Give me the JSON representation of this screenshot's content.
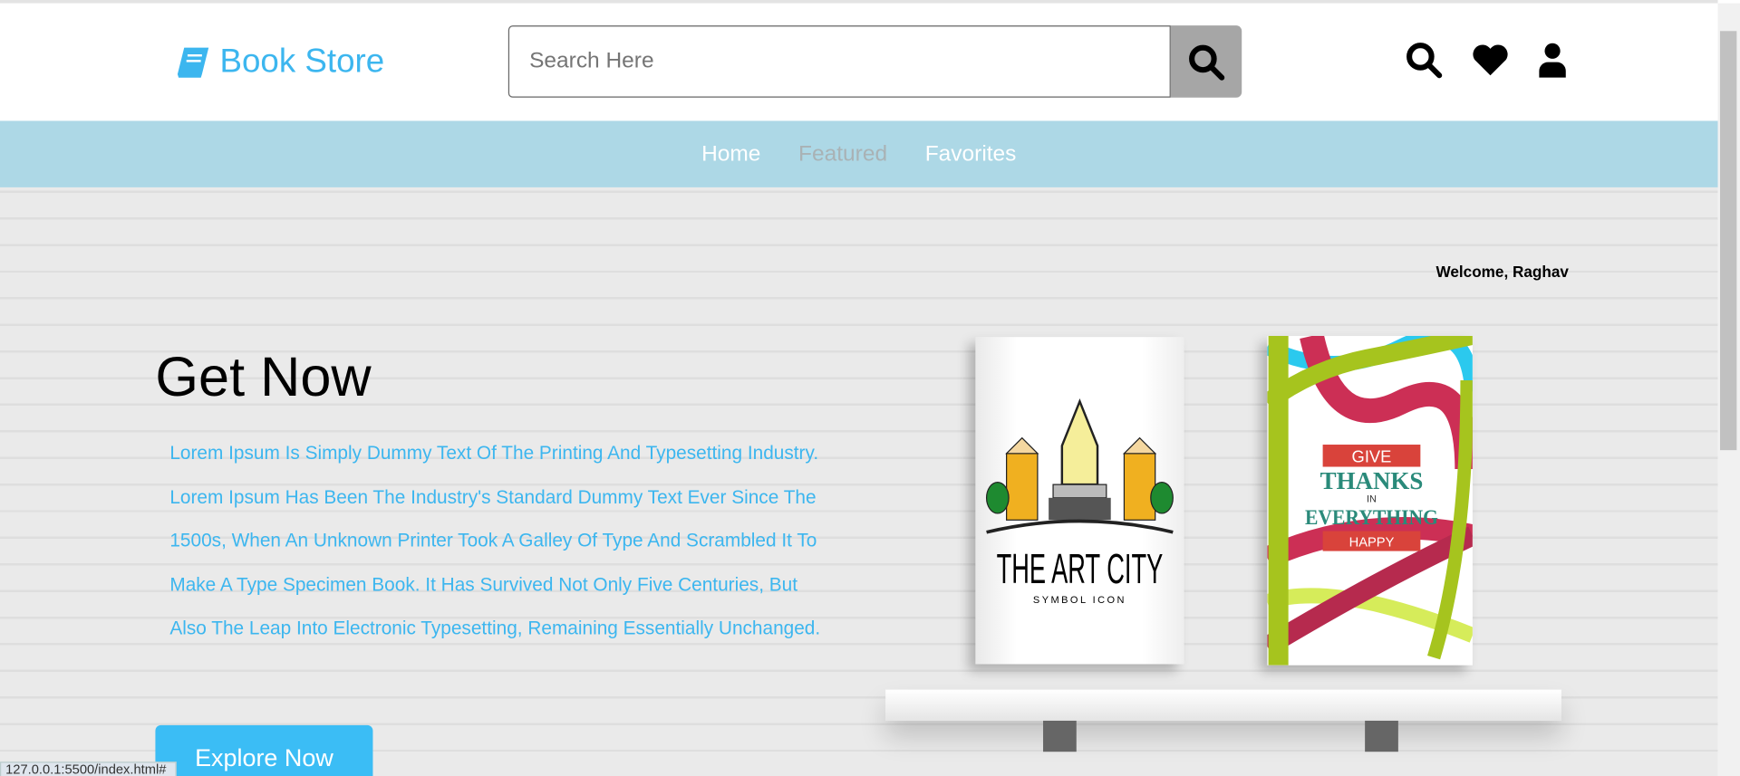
{
  "header": {
    "logo_text": "Book Store",
    "logo_icon": "book-icon",
    "search_placeholder": "Search Here",
    "icons": [
      "search-icon",
      "heart-icon",
      "user-icon"
    ]
  },
  "nav": {
    "items": [
      {
        "label": "Home"
      },
      {
        "label": "Featured",
        "active": true
      },
      {
        "label": "Favorites"
      }
    ]
  },
  "hero": {
    "welcome": "Welcome, Raghav",
    "title": "Get Now",
    "description": "Lorem Ipsum Is Simply Dummy Text Of The Printing And Typesetting Industry. Lorem Ipsum Has Been The Industry's Standard Dummy Text Ever Since The 1500s, When An Unknown Printer Took A Galley Of Type And Scrambled It To Make A Type Specimen Book. It Has Survived Not Only Five Centuries, But Also The Leap Into Electronic Typesetting, Remaining Essentially Unchanged.",
    "button": "Explore Now"
  },
  "books": [
    {
      "title": "THE ART CITY",
      "subtitle": "SYMBOL ICON"
    },
    {
      "lines": [
        "GIVE",
        "THANKS",
        "IN",
        "EVERYTHING",
        "HAPPY"
      ]
    }
  ],
  "status_bar": "127.0.0.1:5500/index.html#",
  "colors": {
    "accent": "#3cb6ef",
    "nav_bg": "#add8e6",
    "button": "#3bbdf5"
  }
}
